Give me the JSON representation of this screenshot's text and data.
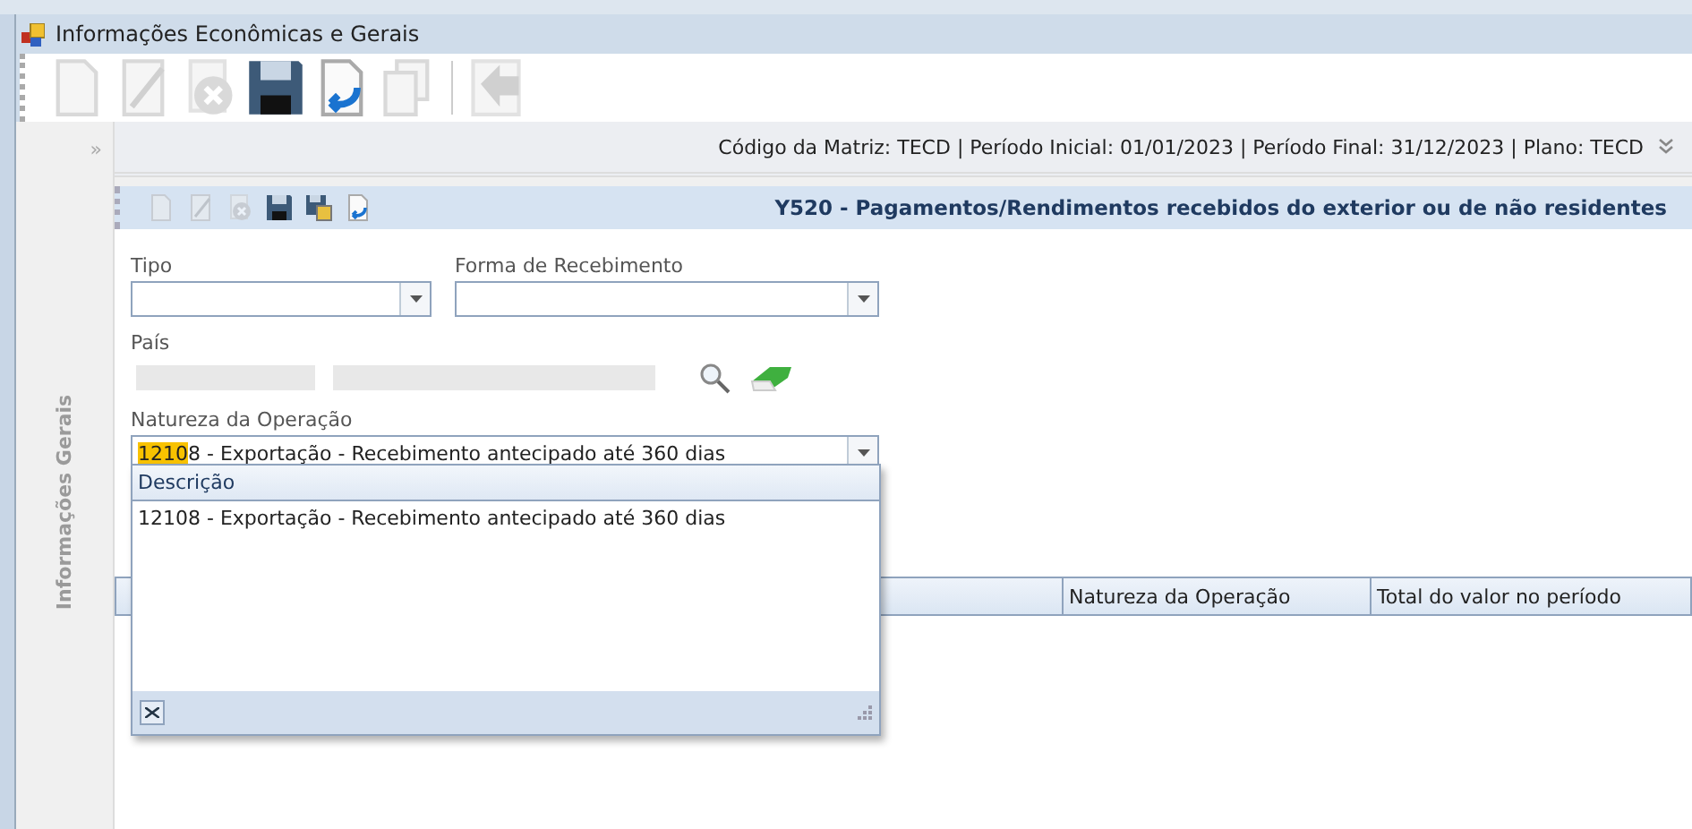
{
  "window": {
    "title": "Informações Econômicas e Gerais"
  },
  "toolbar": [
    {
      "kind": "new",
      "disabled": true
    },
    {
      "kind": "edit",
      "disabled": true
    },
    {
      "kind": "delete",
      "disabled": true
    },
    {
      "kind": "save",
      "disabled": false
    },
    {
      "kind": "undo",
      "disabled": false
    },
    {
      "kind": "copy",
      "disabled": true
    },
    {
      "kind": "separator",
      "disabled": false
    },
    {
      "kind": "back",
      "disabled": true
    }
  ],
  "info_bar": {
    "text": "Código da Matriz: TECD | Período Inicial: 01/01/2023 | Período Final: 31/12/2023 | Plano: TECD"
  },
  "side_panel": {
    "title": "Informações Gerais",
    "expand_glyph": "»"
  },
  "sub_toolbar": [
    {
      "kind": "new",
      "disabled": true
    },
    {
      "kind": "edit",
      "disabled": true
    },
    {
      "kind": "delete",
      "disabled": true
    },
    {
      "kind": "save",
      "disabled": false
    },
    {
      "kind": "saveall",
      "disabled": false
    },
    {
      "kind": "undo",
      "disabled": false
    }
  ],
  "section_title": "Y520 - Pagamentos/Rendimentos recebidos do exterior ou de não residentes",
  "form": {
    "tipo": {
      "label": "Tipo"
    },
    "forma_recebimento": {
      "label": "Forma de Recebimento"
    },
    "pais": {
      "label": "País"
    },
    "natureza": {
      "label": "Natureza da Operação",
      "typed": "1210",
      "completion": "8 - Exportação - Recebimento antecipado até 360 dias"
    }
  },
  "lookup_popup": {
    "column": "Descrição",
    "rows": [
      "12108 - Exportação - Recebimento antecipado até 360 dias"
    ]
  },
  "table": {
    "columns": [
      "",
      "Natureza da Operação",
      "Total do valor no período"
    ]
  }
}
